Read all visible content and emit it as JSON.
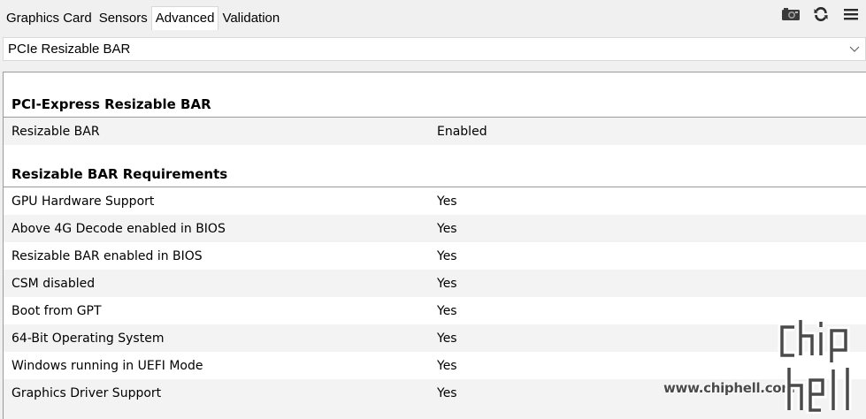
{
  "tabs": [
    {
      "label": "Graphics Card",
      "active": false
    },
    {
      "label": "Sensors",
      "active": false
    },
    {
      "label": "Advanced",
      "active": true
    },
    {
      "label": "Validation",
      "active": false
    }
  ],
  "toolbar": {
    "icons": [
      "camera-icon",
      "refresh-icon",
      "menu-icon"
    ]
  },
  "dropdown": {
    "selected": "PCIe Resizable BAR"
  },
  "sections": [
    {
      "title": "PCI-Express Resizable BAR",
      "rows": [
        {
          "label": "Resizable BAR",
          "value": "Enabled"
        }
      ]
    },
    {
      "title": "Resizable BAR Requirements",
      "rows": [
        {
          "label": "GPU Hardware Support",
          "value": "Yes"
        },
        {
          "label": "Above 4G Decode enabled in BIOS",
          "value": "Yes"
        },
        {
          "label": "Resizable BAR enabled in BIOS",
          "value": "Yes"
        },
        {
          "label": "CSM disabled",
          "value": "Yes"
        },
        {
          "label": "Boot from GPT",
          "value": "Yes"
        },
        {
          "label": "64-Bit Operating System",
          "value": "Yes"
        },
        {
          "label": "Windows running in UEFI Mode",
          "value": "Yes"
        },
        {
          "label": "Graphics Driver Support",
          "value": "Yes"
        }
      ]
    }
  ],
  "watermark": {
    "text": "www.chiphell.com",
    "logo": "chiphell"
  }
}
